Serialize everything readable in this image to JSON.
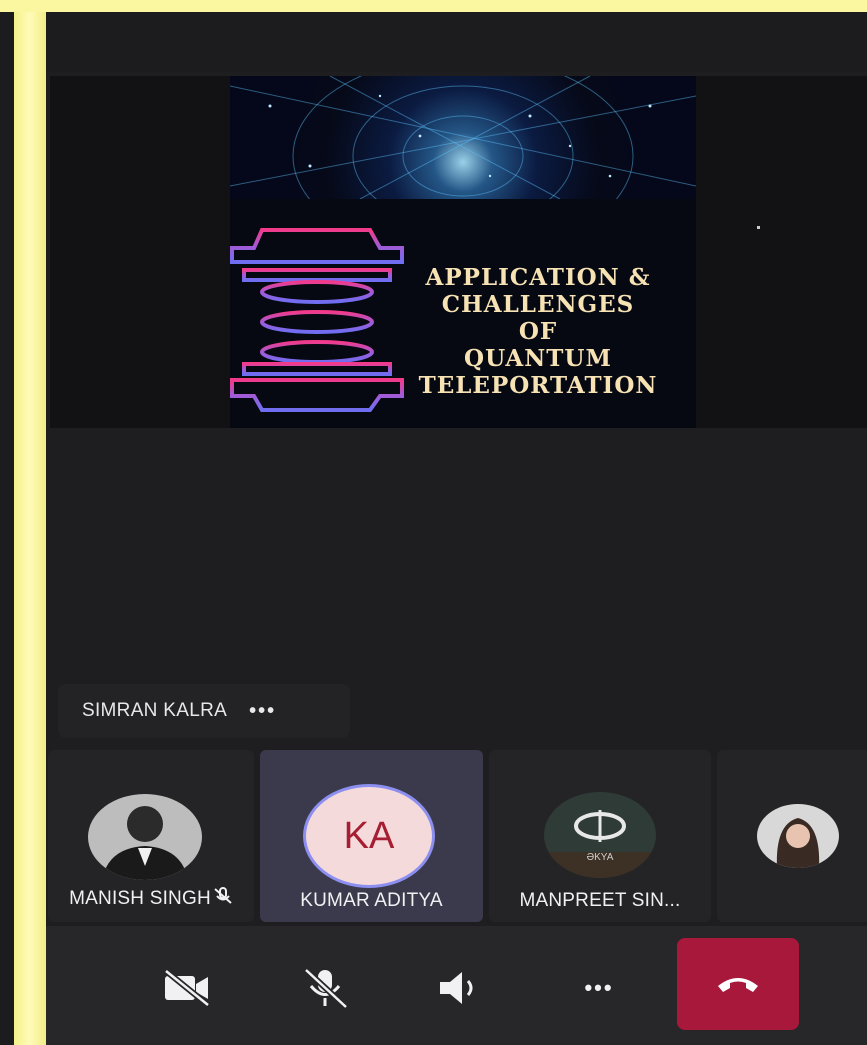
{
  "slide": {
    "title_lines": [
      "APPLICATION &",
      "CHALLENGES",
      "OF",
      "QUANTUM",
      "TELEPORTATION"
    ]
  },
  "speaker": {
    "name": "SIMRAN KALRA",
    "more_label": "•••"
  },
  "participants": [
    {
      "name": "MANISH SINGH",
      "muted": true,
      "avatar": "photo"
    },
    {
      "name": "KUMAR ADITYA",
      "initials": "KA",
      "active": true
    },
    {
      "name": "MANPREET SIN...",
      "avatar": "eye-logo"
    },
    {
      "name": "",
      "avatar": "photo"
    }
  ],
  "controls": {
    "camera": "video-off-icon",
    "mic": "mic-off-icon",
    "speaker": "speaker-icon",
    "more": "•••",
    "hangup": "phone-hangup-icon"
  },
  "colors": {
    "hangup": "#a7183b",
    "avatar_ring": "#8c8ef0",
    "initials": "#a51e31"
  }
}
